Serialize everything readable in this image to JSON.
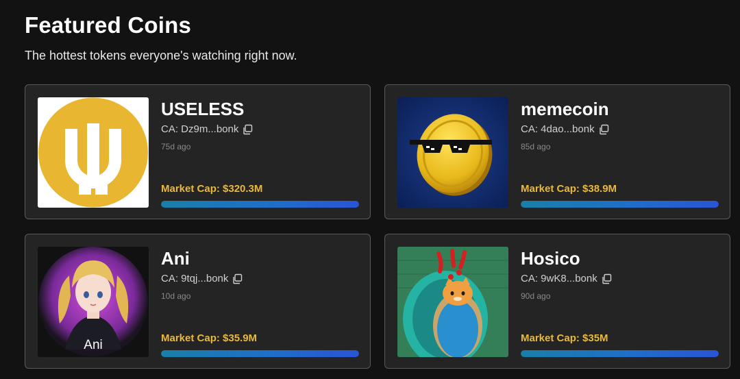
{
  "header": {
    "title": "Featured Coins",
    "subtitle": "The hottest tokens everyone's watching right now."
  },
  "coins": [
    {
      "name": "USELESS",
      "ca": "CA: Dz9m...bonk",
      "age": "75d ago",
      "market_cap": "Market Cap: $320.3M",
      "progress": 1.0,
      "image_icon": "useless-logo-icon"
    },
    {
      "name": "memecoin",
      "ca": "CA: 4dao...bonk",
      "age": "85d ago",
      "market_cap": "Market Cap: $38.9M",
      "progress": 1.0,
      "image_icon": "memecoin-logo-icon"
    },
    {
      "name": "Ani",
      "ca": "CA: 9tqj...bonk",
      "age": "10d ago",
      "market_cap": "Market Cap: $35.9M",
      "progress": 1.0,
      "image_icon": "ani-avatar-icon",
      "image_caption": "Ani"
    },
    {
      "name": "Hosico",
      "ca": "CA: 9wK8...bonk",
      "age": "90d ago",
      "market_cap": "Market Cap: $35M",
      "progress": 1.0,
      "image_icon": "hosico-cat-icon"
    }
  ],
  "colors": {
    "background": "#121212",
    "card": "#242424",
    "card_border": "#5a5a5a",
    "market_cap": "#e8b93a",
    "bar_start": "#1a7fa8",
    "bar_end": "#2a54d6"
  }
}
